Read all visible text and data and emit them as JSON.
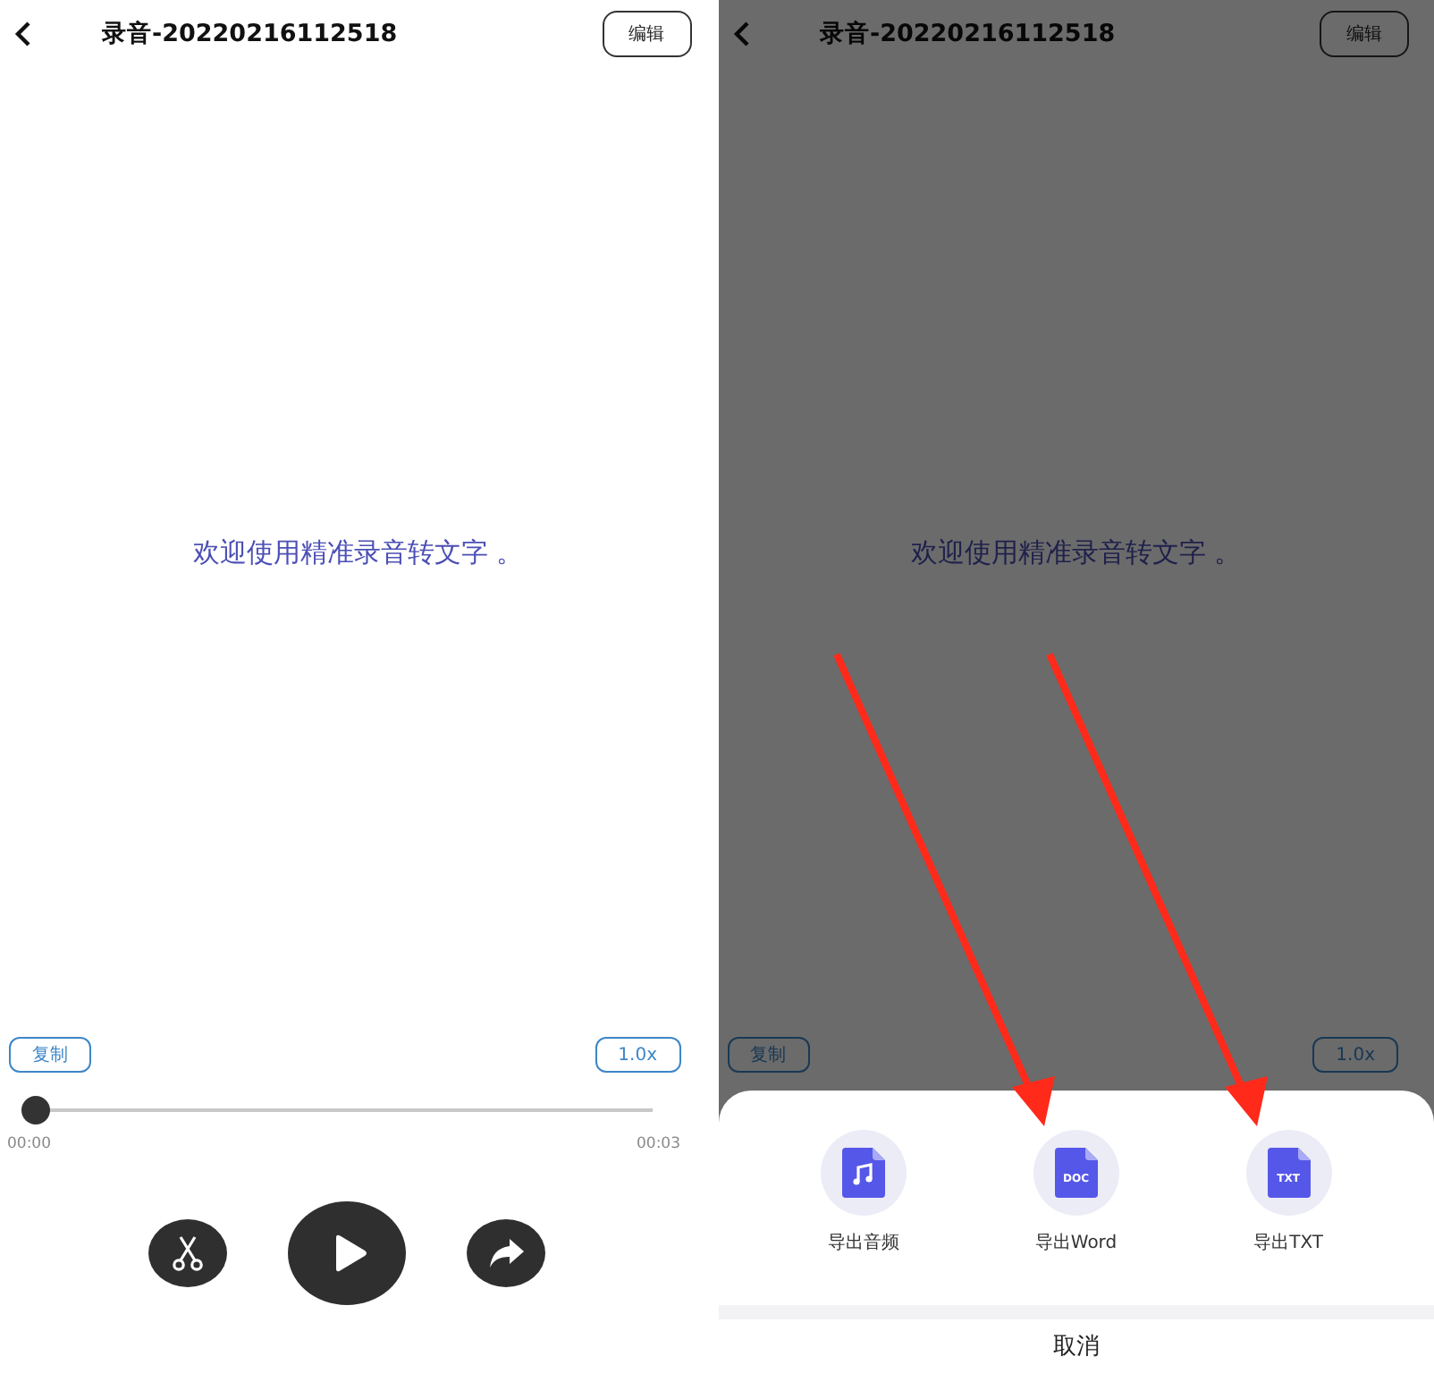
{
  "screens": [
    {
      "dimmed": false,
      "title": "录音-20220216112518",
      "edit_button": "编辑",
      "transcript": "欢迎使用精准录音转文字 。",
      "copy_button": "复制",
      "speed_button": "1.0x",
      "progress": {
        "level": 0,
        "elapsed": "00:00",
        "total": "00:03"
      },
      "show_controls": true
    },
    {
      "dimmed": true,
      "title": "录音-20220216112518",
      "edit_button": "编辑",
      "transcript": "欢迎使用精准录音转文字 。",
      "copy_button": "复制",
      "speed_button": "1.0x",
      "export_sheet": {
        "options": [
          {
            "kind": "audio",
            "label": "导出音频",
            "arrow": false
          },
          {
            "kind": "document",
            "badge": "DOC",
            "label": "导出Word",
            "arrow": true
          },
          {
            "kind": "document",
            "badge": "TXT",
            "label": "导出TXT",
            "arrow": true
          }
        ],
        "cancel": "取消"
      }
    }
  ]
}
